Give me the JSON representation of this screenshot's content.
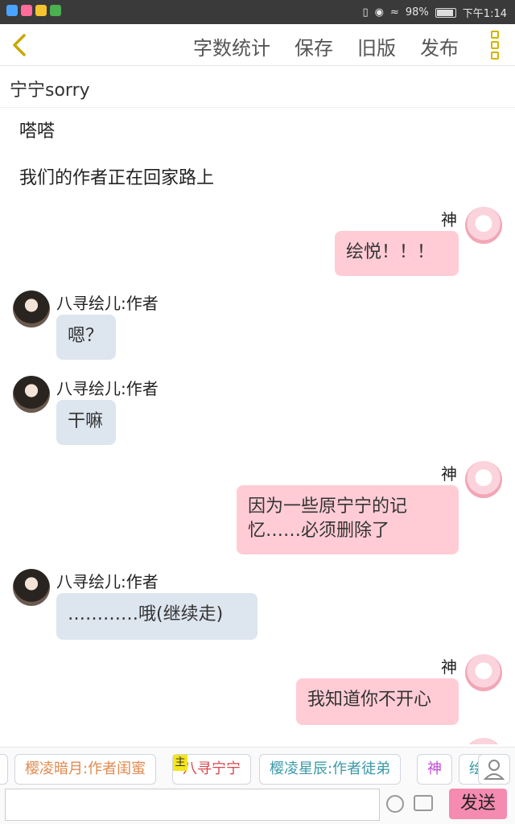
{
  "status_bar": {
    "battery": "98%",
    "time": "下午1:14"
  },
  "toolbar": {
    "items": [
      "字数统计",
      "保存",
      "旧版",
      "发布"
    ]
  },
  "title": "宁宁sorry",
  "narration": [
    "嗒嗒",
    "我们的作者正在回家路上"
  ],
  "messages": [
    {
      "sender": "神",
      "text": "绘悦！！！"
    },
    {
      "sender": "八寻绘儿:作者",
      "text": "嗯？"
    },
    {
      "sender": "八寻绘儿:作者",
      "text": "干嘛"
    },
    {
      "sender": "神",
      "text_line1": "因为一些原宁宁的记",
      "text_line2": "忆……必须删除了"
    },
    {
      "sender": "八寻绘儿:作者",
      "text": "…………哦(继续走)"
    },
    {
      "sender": "神",
      "text": "我知道你不开心"
    }
  ],
  "characters": {
    "crown": "主",
    "items": [
      "樱凌暗月:作者闺蜜",
      "八寻宁宁",
      "樱凌星辰:作者徒弟",
      "神",
      "绘"
    ]
  },
  "input": {
    "placeholder": "",
    "send_label": "发送"
  }
}
